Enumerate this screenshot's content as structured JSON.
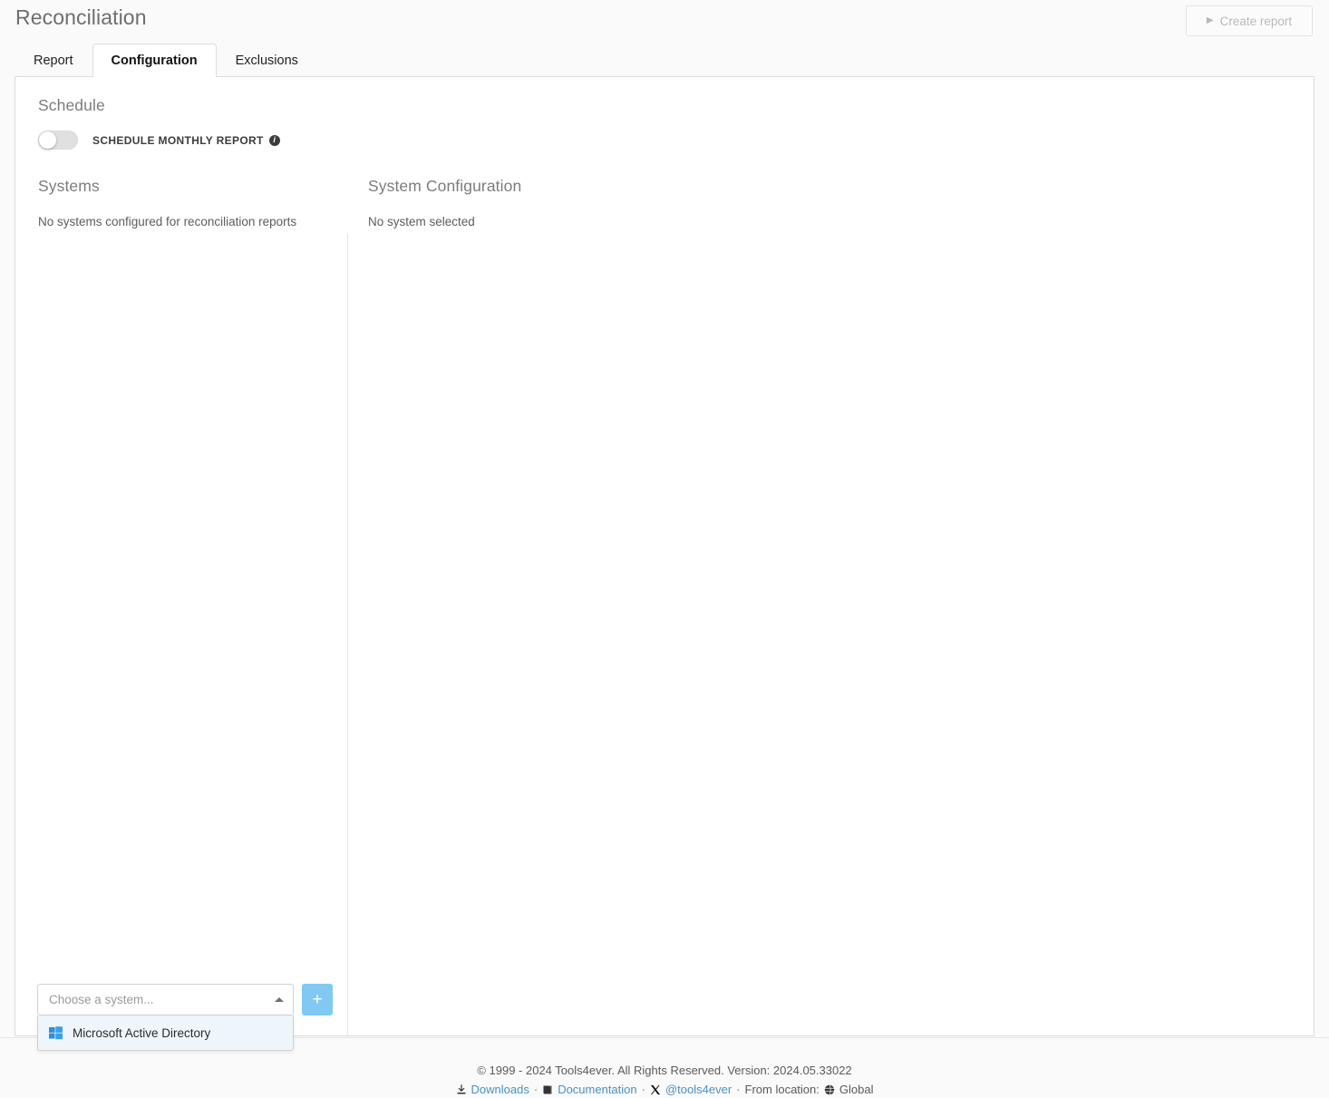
{
  "header": {
    "title": "Reconciliation",
    "create_report_label": "Create report",
    "create_report_icon": "play-icon"
  },
  "tabs": [
    {
      "label": "Report",
      "active": false
    },
    {
      "label": "Configuration",
      "active": true
    },
    {
      "label": "Exclusions",
      "active": false
    }
  ],
  "schedule": {
    "heading": "Schedule",
    "toggle_label": "SCHEDULE MONTHLY REPORT",
    "toggle_state": "off",
    "info_icon": "info-icon",
    "info_glyph": "i"
  },
  "systems": {
    "heading": "Systems",
    "empty_text": "No systems configured for reconciliation reports"
  },
  "system_configuration": {
    "heading": "System Configuration",
    "empty_text": "No system selected"
  },
  "picker": {
    "placeholder": "Choose a system...",
    "caret_icon": "chevron-up-icon",
    "add_label": "+",
    "options": [
      {
        "label": "Microsoft Active Directory",
        "icon": "windows-icon"
      }
    ]
  },
  "footer": {
    "copyright": "© 1999 - 2024 Tools4ever. All Rights Reserved. Version: 2024.05.33022",
    "downloads_label": "Downloads",
    "downloads_icon": "download-icon",
    "documentation_label": "Documentation",
    "documentation_icon": "book-icon",
    "twitter_label": "@tools4ever",
    "twitter_icon": "x-twitter-icon",
    "location_prefix": "From location:",
    "location_label": "Global",
    "location_icon": "globe-icon",
    "separator": "·"
  },
  "colors": {
    "accent_blue": "#7fc9f2",
    "link_blue": "#4a90c4",
    "page_background": "#fafafa",
    "card_background": "#ffffff",
    "border": "#dcdcdc"
  }
}
